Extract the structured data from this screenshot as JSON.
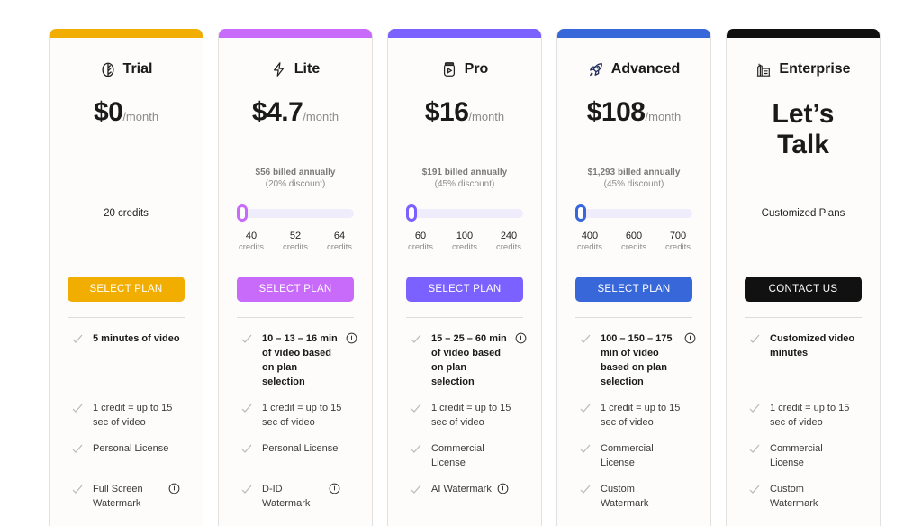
{
  "plans": [
    {
      "name": "Trial",
      "icon": "leaf-icon",
      "accent": "#f2ae00",
      "price": "$0",
      "per": "/month",
      "credits_text": "20 credits",
      "button": "SELECT PLAN",
      "features": [
        {
          "text": "5 minutes of video",
          "bold": true,
          "info": false
        },
        {
          "text": "1 credit = up to 15 sec of video",
          "bold": false,
          "info": false
        },
        {
          "text": "Personal License",
          "bold": false,
          "info": false
        },
        {
          "text": "Full Screen Watermark",
          "bold": false,
          "info": true
        }
      ]
    },
    {
      "name": "Lite",
      "icon": "lightning-icon",
      "accent": "#c86bfa",
      "price": "$4.7",
      "per": "/month",
      "billed": "$56 billed annually",
      "discount": "(20% discount)",
      "slider_value": 0,
      "credit_options": [
        "40",
        "52",
        "64"
      ],
      "credit_unit": "credits",
      "button": "SELECT PLAN",
      "features": [
        {
          "text": "10 – 13 – 16 min of video based on plan selection",
          "bold": true,
          "info": true
        },
        {
          "text": "1 credit = up to 15 sec of video",
          "bold": false,
          "info": false
        },
        {
          "text": "Personal License",
          "bold": false,
          "info": false
        },
        {
          "text": "D-ID Watermark",
          "bold": false,
          "info": true
        }
      ]
    },
    {
      "name": "Pro",
      "icon": "video-jar-icon",
      "accent": "#7b61ff",
      "price": "$16",
      "per": "/month",
      "billed": "$191 billed annually",
      "discount": "(45% discount)",
      "slider_value": 0,
      "credit_options": [
        "60",
        "100",
        "240"
      ],
      "credit_unit": "credits",
      "button": "SELECT PLAN",
      "features": [
        {
          "text": "15 – 25 – 60 min of video based on plan selection",
          "bold": true,
          "info": true
        },
        {
          "text": "1 credit = up to 15 sec of video",
          "bold": false,
          "info": false
        },
        {
          "text": "Commercial License",
          "bold": false,
          "info": false
        },
        {
          "text": "AI Watermark",
          "bold": false,
          "info": true
        }
      ]
    },
    {
      "name": "Advanced",
      "icon": "rocket-icon",
      "accent": "#3867d9",
      "price": "$108",
      "per": "/month",
      "billed": "$1,293 billed annually",
      "discount": "(45% discount)",
      "slider_value": 0,
      "credit_options": [
        "400",
        "600",
        "700"
      ],
      "credit_unit": "credits",
      "button": "SELECT PLAN",
      "features": [
        {
          "text": "100 – 150 – 175 min of video based on plan selection",
          "bold": true,
          "info": true
        },
        {
          "text": "1 credit = up to 15 sec of video",
          "bold": false,
          "info": false
        },
        {
          "text": "Commercial License",
          "bold": false,
          "info": false
        },
        {
          "text": "Custom Watermark",
          "bold": false,
          "info": false
        }
      ]
    },
    {
      "name": "Enterprise",
      "icon": "building-icon",
      "accent": "#111111",
      "headline": "Let’s Talk",
      "credits_text": "Customized Plans",
      "button": "CONTACT US",
      "features": [
        {
          "text": "Customized video minutes",
          "bold": true,
          "info": false
        },
        {
          "text": "1 credit = up to 15 sec of video",
          "bold": false,
          "info": false
        },
        {
          "text": "Commercial License",
          "bold": false,
          "info": false
        },
        {
          "text": "Custom Watermark",
          "bold": false,
          "info": false
        }
      ]
    }
  ]
}
